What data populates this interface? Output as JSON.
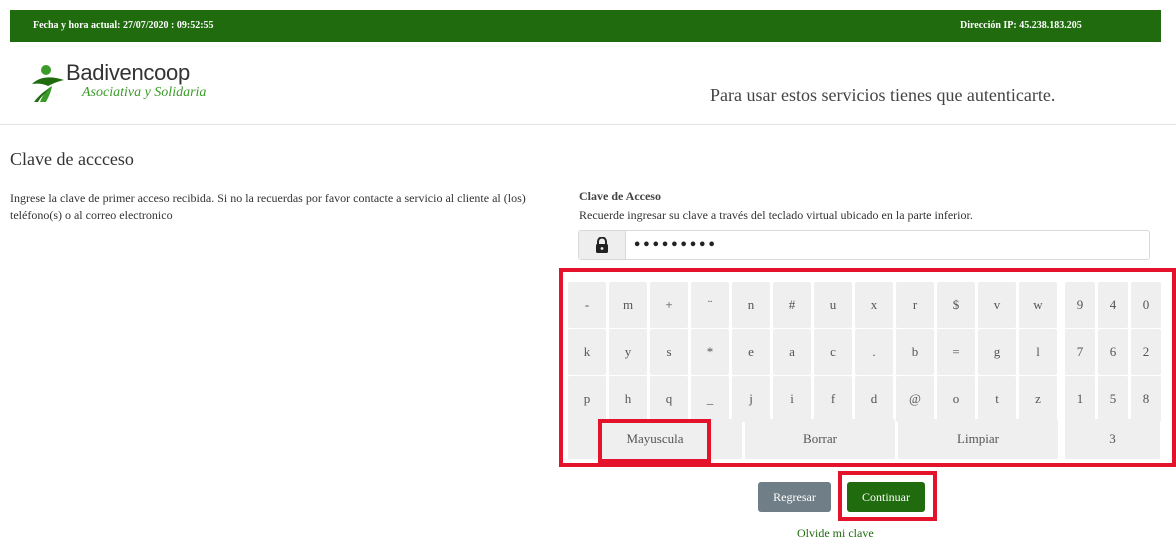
{
  "topbar": {
    "datetime": "Fecha y hora actual: 27/07/2020 : 09:52:55",
    "ip": "Dirección IP: 45.238.183.205",
    "color": "#1f6b0e"
  },
  "brand": {
    "name": "Badivencoop",
    "tagline": "Asociativa y Solidaria",
    "icon": "person-leaf-logo"
  },
  "header": {
    "auth_message": "Para usar estos servicios tienes que autenticarte."
  },
  "page": {
    "title": "Clave de accceso",
    "intro": "Ingrese la clave de primer acceso recibida. Si no la recuerdas por favor contacte a servicio al cliente al (los) teléfono(s) o al correo electronico"
  },
  "password": {
    "label": "Clave de Acceso",
    "help": "Recuerde ingresar su clave a través del teclado virtual ubicado en la parte inferior.",
    "value": "•••••••••",
    "icon": "lock-icon"
  },
  "keyboard": {
    "rows": [
      [
        "-",
        "m",
        "+",
        "¨",
        "n",
        "#",
        "u",
        "x",
        "r",
        "$",
        "v",
        "w"
      ],
      [
        "k",
        "y",
        "s",
        "*",
        "e",
        "a",
        "c",
        ".",
        "b",
        "=",
        "g",
        "l"
      ],
      [
        "p",
        "h",
        "q",
        "_",
        "j",
        "i",
        "f",
        "d",
        "@",
        "o",
        "t",
        "z"
      ]
    ],
    "numpad": [
      [
        "9",
        "4",
        "0"
      ],
      [
        "7",
        "6",
        "2"
      ],
      [
        "1",
        "5",
        "8"
      ]
    ],
    "bottom": {
      "mayus": "Mayuscula",
      "borrar": "Borrar",
      "limpiar": "Limpiar",
      "extra": "3"
    }
  },
  "actions": {
    "back": "Regresar",
    "continue": "Continuar",
    "forgot": "Olvide mi clave"
  },
  "colors": {
    "accent": "#1f6b0e",
    "highlight": "#e4122a",
    "key": "#efefef",
    "back": "#707f87"
  }
}
